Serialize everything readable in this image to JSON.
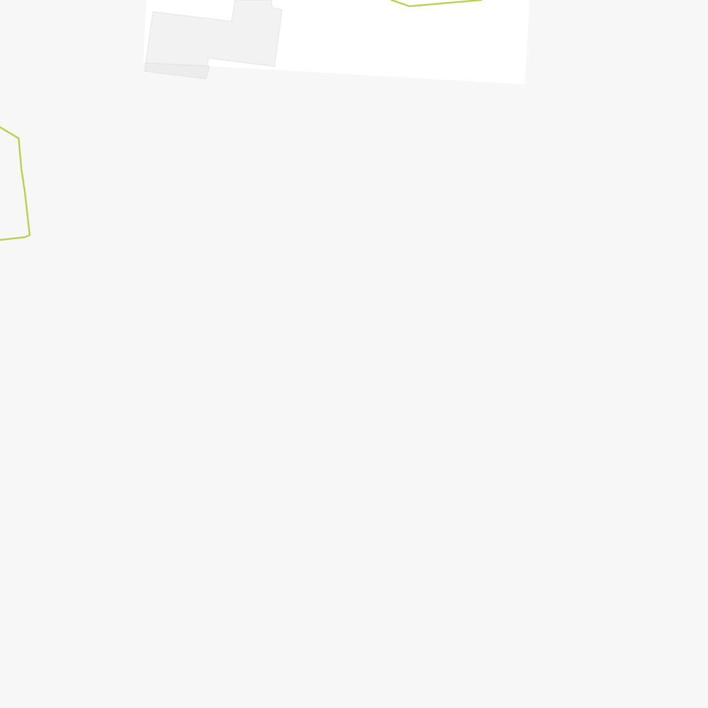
{
  "map": {
    "colors": {
      "background": "#f7f7f7",
      "paved_area": "#ffffff",
      "building_fill": "#f2f2f2",
      "building_stroke": "#e4e4e4",
      "building_shadow": "#ececec",
      "boundary_line": "#b9d14f"
    }
  }
}
